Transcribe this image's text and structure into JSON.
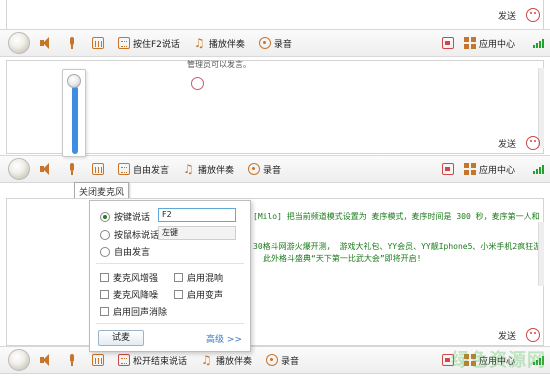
{
  "panel1": {
    "send_label": "发送",
    "toolbar": {
      "voice_mode_label": "按住F2说话",
      "accompaniment_label": "播放伴奏",
      "record_label": "录音",
      "app_center_label": "应用中心"
    }
  },
  "panel2": {
    "notice_text": "管理员可以发言。",
    "send_label": "发送",
    "tooltip": "关闭麦克风",
    "toolbar": {
      "voice_mode_label": "自由发言",
      "accompaniment_label": "播放伴奏",
      "record_label": "录音",
      "app_center_label": "应用中心"
    }
  },
  "panel3": {
    "message_line1": "[Milo] 把当前频道模式设置为 麦序模式，麦序时间是 300 秒，麦序第一人和",
    "message_line2": "30格斗网游火爆开测， 游戏大礼包、YY会员、YY靓Iphone5、小米手机2疯狂游",
    "message_line3": "此外格斗盛典“天下第一比武大会”即将开启!",
    "send_label": "发送",
    "toolbar": {
      "voice_mode_label": "松开结束说话",
      "accompaniment_label": "播放伴奏",
      "record_label": "录音",
      "app_center_label": "应用中心"
    }
  },
  "settings_popup": {
    "options": [
      {
        "label": "按键说话",
        "checked": true
      },
      {
        "label": "按鼠标说话",
        "checked": false
      },
      {
        "label": "自由发言",
        "checked": false
      }
    ],
    "hotkey_value": "F2",
    "mouse_value": "左键",
    "checkboxes": [
      {
        "label": "麦克风增强",
        "checked": false
      },
      {
        "label": "启用混响",
        "checked": false
      },
      {
        "label": "麦克风降噪",
        "checked": false
      },
      {
        "label": "启用变声",
        "checked": false
      },
      {
        "label": "启用回声消除",
        "checked": false
      }
    ],
    "test_button": "试麦",
    "advanced_link": "高级 >>"
  },
  "watermark": "绿色资源网",
  "colors": {
    "accent_green": "#28a745",
    "slider_blue": "#3f8ce0",
    "icon_orange": "#c8752c",
    "link_blue": "#3a78c8"
  }
}
